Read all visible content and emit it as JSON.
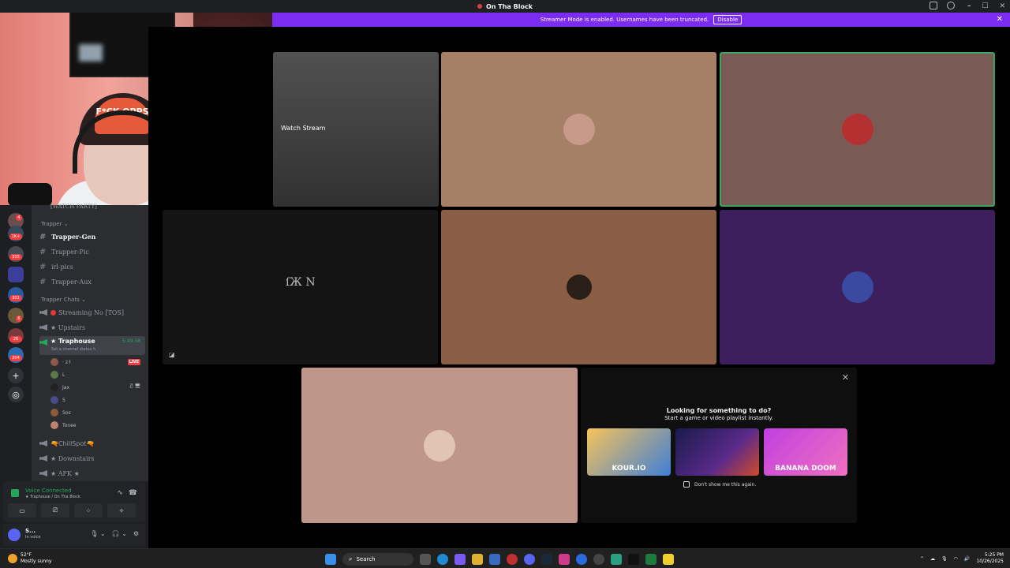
{
  "titlebar": {
    "title": "On Tha Block"
  },
  "banner": {
    "text": "Streamer Mode is enabled. Usernames have been truncated.",
    "button": "Disable",
    "close": "✕"
  },
  "window": {
    "minimize": "–",
    "maximize": "☐",
    "close": "✕"
  },
  "webcam": {
    "cap_text": "F*CK OPPS"
  },
  "rail": {
    "badges": [
      "4",
      "1K+",
      "335",
      "301",
      "6",
      "26",
      "204"
    ],
    "add": "+",
    "explore": "◎"
  },
  "channels": {
    "watch_party": "[WATCH PARTY]",
    "cat_trapper": "Trapper ⌄",
    "items": [
      "Trapper-Gen",
      "Trapper-Pic",
      "irl-pics",
      "Trapper-Aux"
    ],
    "cat_chats": "Trapper Chats ⌄",
    "voice": [
      {
        "label": "Streaming No [TOS]"
      },
      {
        "label": "★ Upstairs"
      },
      {
        "label": "★ Traphouse",
        "timer": "5:49:38",
        "status": "Set a channel status ✎"
      },
      {
        "label": "🔫ChillSpot🔫"
      },
      {
        "label": "★ Downstairs"
      },
      {
        "label": "★ AFK ★"
      }
    ],
    "users": [
      {
        "name": "· z ł",
        "live": "LIVE"
      },
      {
        "name": "L"
      },
      {
        "name": "Jax"
      },
      {
        "name": "S"
      },
      {
        "name": "Sos"
      },
      {
        "name": "Tonee"
      }
    ]
  },
  "voice_panel": {
    "title": "Voice Connected",
    "sub": "★ Traphouse / On Tha Block",
    "hang": "☎",
    "wave": "∿"
  },
  "user_panel": {
    "name": "S...",
    "status": "In voice",
    "mic": "🎙 ⌄",
    "head": "🎧 ⌄",
    "gear": "⚙"
  },
  "stage": {
    "watch_stream": "Watch Stream",
    "nike_text": "ſЖ N",
    "activity": {
      "heading": "Looking for something to do?",
      "sub": "Start a game or video playlist instantly.",
      "games": [
        "KOUR.IO",
        "",
        "BANANA DOOM"
      ],
      "dont_show": "Don't show me this again.",
      "close": "✕"
    }
  },
  "taskbar": {
    "weather_temp": "52°F",
    "weather_desc": "Mostly sunny",
    "search": "Search",
    "time": "5:25 PM",
    "date": "10/26/2025"
  }
}
